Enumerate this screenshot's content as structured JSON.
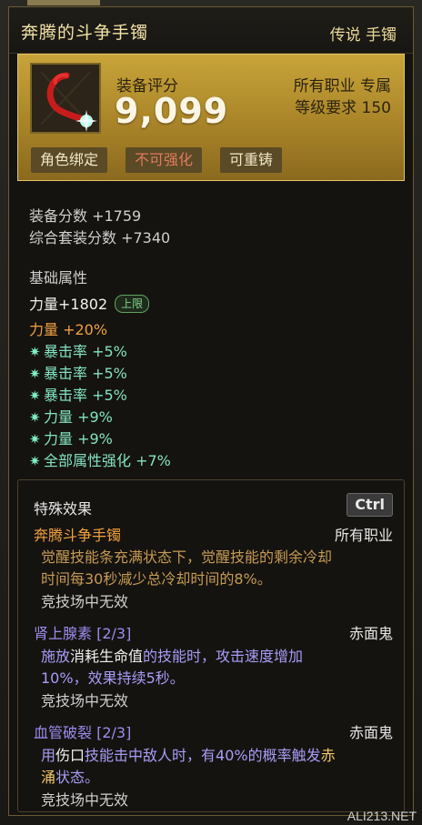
{
  "item": {
    "name": "奔腾的斗争手镯",
    "rarity": "传说 手镯",
    "score_label": "装备评分",
    "score_value": "9,099",
    "job": "所有职业 专属",
    "level_req": "等级要求 150",
    "tags": [
      "角色绑定",
      "不可强化",
      "可重铸"
    ]
  },
  "scores": {
    "equip": "装备分数 +1759",
    "set": "综合套装分数 +7340"
  },
  "base": {
    "title": "基础属性",
    "strength": "力量+1802",
    "badge": "上限",
    "lines": [
      {
        "text": "力量 +20%",
        "style": "orange",
        "star": false
      },
      {
        "text": "暴击率 +5%",
        "style": "green",
        "star": true
      },
      {
        "text": "暴击率 +5%",
        "style": "green",
        "star": true
      },
      {
        "text": "暴击率 +5%",
        "style": "green",
        "star": true
      },
      {
        "text": "力量 +9%",
        "style": "green",
        "star": true
      },
      {
        "text": "力量 +9%",
        "style": "green",
        "star": true
      },
      {
        "text": "全部属性强化 +7%",
        "style": "green",
        "star": true
      }
    ]
  },
  "special": {
    "title": "特殊效果",
    "ctrl": "Ctrl",
    "set": {
      "name": "奔腾斗争手镯",
      "job": "所有职业",
      "desc1": "觉醒技能条充满状态下，觉醒技能的剩余冷却",
      "desc2": "时间每30秒减少总冷却时间的8%。",
      "arena": "竞技场中无效"
    },
    "skill1": {
      "name": "肾上腺素 [2/3]",
      "job": "赤面鬼",
      "d1a": "施放",
      "d1b": "消耗生命值",
      "d1c": "的技能时，攻击速度增加",
      "desc2": "10%，效果持续5秒。",
      "arena": "竞技场中无效"
    },
    "skill2": {
      "name": "血管破裂 [2/3]",
      "job": "赤面鬼",
      "d1a": "用",
      "d1b": "伤口",
      "d1c": "技能击中敌人时，有40%的概率触发",
      "d1d": "赤",
      "d2a": "涌",
      "d2b": "状态。",
      "arena": "竞技场中无效"
    }
  },
  "watermark": "ALI213.NET"
}
